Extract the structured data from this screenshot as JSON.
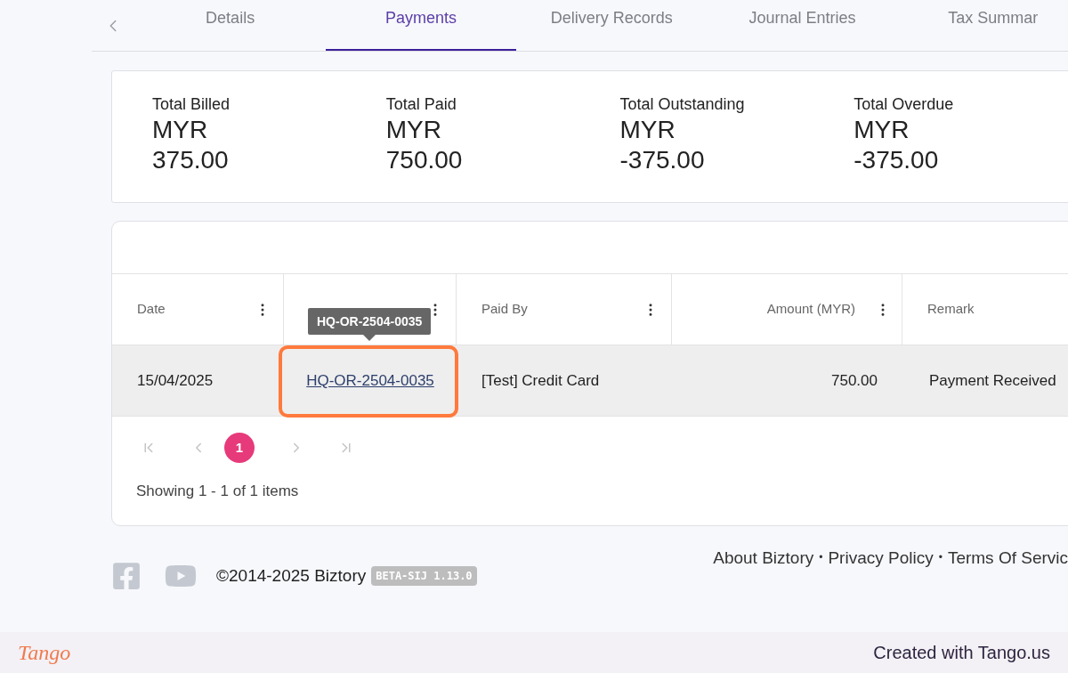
{
  "tabs": [
    {
      "label": "Details",
      "selected": false
    },
    {
      "label": "Payments",
      "selected": true
    },
    {
      "label": "Delivery Records",
      "selected": false
    },
    {
      "label": "Journal Entries",
      "selected": false
    },
    {
      "label": "Tax Summar",
      "selected": false
    }
  ],
  "summary": [
    {
      "label": "Total Billed",
      "currency": "MYR",
      "amount": "375.00"
    },
    {
      "label": "Total Paid",
      "currency": "MYR",
      "amount": "750.00"
    },
    {
      "label": "Total Outstanding",
      "currency": "MYR",
      "amount": "-375.00"
    },
    {
      "label": "Total Overdue",
      "currency": "MYR",
      "amount": "-375.00"
    }
  ],
  "table": {
    "columns": [
      {
        "label": "Date",
        "menu": true
      },
      {
        "menu": true
      },
      {
        "label": "Paid By",
        "menu": true
      },
      {
        "label": "Amount (MYR)",
        "menu": true
      },
      {
        "label": "Remark",
        "menu": false
      }
    ],
    "rows": [
      {
        "date": "15/04/2025",
        "ref_no": "HQ-OR-2504-0035",
        "paid_by": "[Test] Credit Card",
        "amount": "750.00",
        "remark": "Payment Received",
        "selected": true
      }
    ],
    "tooltip": "HQ-OR-2504-0035"
  },
  "pagination": {
    "pages": [
      {
        "label": "1",
        "selected": true
      }
    ],
    "info": "Showing 1 - 1 of 1 items"
  },
  "footer": {
    "copyright": "©2014-2025 Biztory",
    "version": "BETA-SIJ 1.13.0",
    "links": [
      "About Biztory",
      "Privacy Policy",
      "Terms Of Servic"
    ],
    "separator": "•"
  },
  "tango": {
    "logo": "Tango",
    "credit": "Created with Tango.us"
  }
}
